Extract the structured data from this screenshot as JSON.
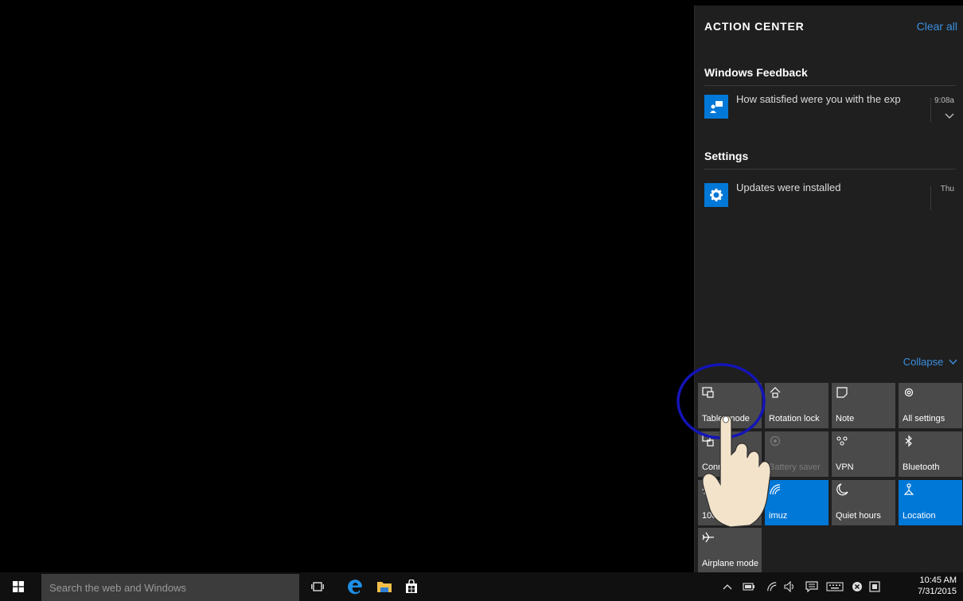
{
  "action_center": {
    "title": "ACTION CENTER",
    "clear_all": "Clear all",
    "groups": [
      {
        "title": "Windows Feedback",
        "notification": {
          "text": "How satisfied were you with the exp",
          "time": "9:08a",
          "icon": "feedback-icon"
        }
      },
      {
        "title": "Settings",
        "notification": {
          "text": "Updates were installed",
          "time": "Thu",
          "icon": "gear-icon"
        }
      }
    ],
    "collapse_label": "Collapse",
    "quick_actions": [
      {
        "label": "Tablet mode",
        "icon": "tablet-mode-icon",
        "state": "off"
      },
      {
        "label": "Rotation lock",
        "icon": "rotation-lock-icon",
        "state": "off"
      },
      {
        "label": "Note",
        "icon": "note-icon",
        "state": "off"
      },
      {
        "label": "All settings",
        "icon": "gear-icon",
        "state": "off"
      },
      {
        "label": "Connect",
        "icon": "connect-icon",
        "state": "off"
      },
      {
        "label": "Battery saver",
        "icon": "battery-saver-icon",
        "state": "disabled"
      },
      {
        "label": "VPN",
        "icon": "vpn-icon",
        "state": "off"
      },
      {
        "label": "Bluetooth",
        "icon": "bluetooth-icon",
        "state": "off"
      },
      {
        "label": "100%",
        "icon": "brightness-icon",
        "state": "off"
      },
      {
        "label": "imuz",
        "icon": "wifi-icon",
        "state": "on"
      },
      {
        "label": "Quiet hours",
        "icon": "moon-icon",
        "state": "off"
      },
      {
        "label": "Location",
        "icon": "location-icon",
        "state": "on"
      },
      {
        "label": "Airplane mode",
        "icon": "airplane-icon",
        "state": "off"
      }
    ]
  },
  "taskbar": {
    "search_placeholder": "Search the web and Windows",
    "clock_time": "10:45 AM",
    "clock_date": "7/31/2015"
  },
  "colors": {
    "accent": "#0078d7",
    "link": "#3b8fe0",
    "tile": "#4a4a4a",
    "panel": "#1f1f1f"
  }
}
